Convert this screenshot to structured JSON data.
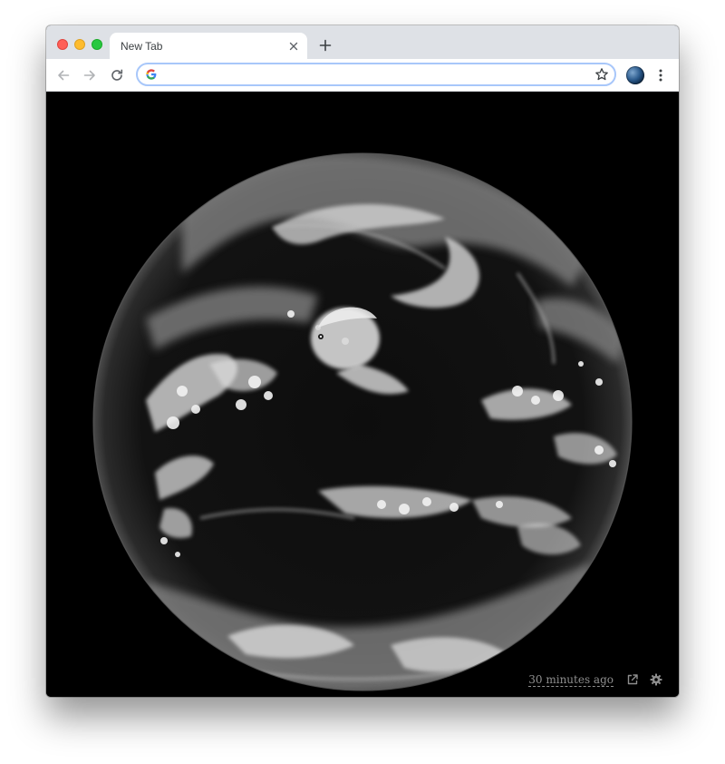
{
  "browser": {
    "tab": {
      "title": "New Tab"
    },
    "omnibox": {
      "value": "",
      "placeholder": ""
    }
  },
  "page": {
    "image": "full-disk satellite image of Earth",
    "footer": {
      "time_ago": "30 minutes ago"
    }
  },
  "icons": {
    "window_controls": [
      "close-window-icon",
      "minimize-window-icon",
      "maximize-window-icon"
    ],
    "tab": [
      "close-tab-icon",
      "new-tab-icon"
    ],
    "toolbar": [
      "back-icon",
      "forward-icon",
      "reload-icon",
      "google-icon",
      "bookmark-star-icon",
      "extension-earth-icon",
      "menu-icon"
    ],
    "footer": [
      "external-link-icon",
      "settings-gear-icon"
    ]
  },
  "colors": {
    "tab_strip": "#dee1e6",
    "omnibox_focus": "#a8c7fa",
    "page_background": "#000000",
    "footer_text": "#8e8e8e"
  }
}
